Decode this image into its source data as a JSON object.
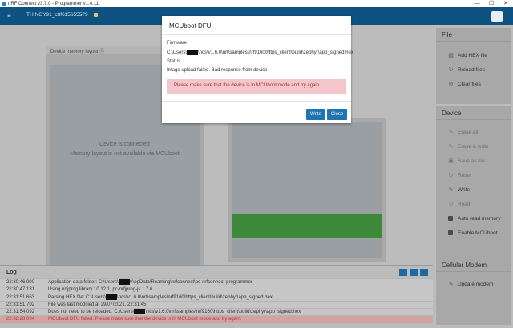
{
  "window": {
    "title": "nRF Connect v3.7.0 - Programmer v1.4.11",
    "controls": [
      "—",
      "☐",
      "✕"
    ]
  },
  "nav": {
    "menu_icon": "≡",
    "device_name": "THINGY91_c8f615655579",
    "device_chevron": "▾"
  },
  "workspace": {
    "left_panel_title": "Device memory layout",
    "left_panel_info_icon": "ⓘ",
    "left_panel_collapse": "▭",
    "device_connected": "Device is connected",
    "memory_layout_unavailable": "Memory layout is not available via MCUboot"
  },
  "sidebar": {
    "file": {
      "title": "File",
      "items": [
        {
          "label": "Add HEX file",
          "icon": "▤"
        },
        {
          "label": "Reload files",
          "icon": "↻"
        },
        {
          "label": "Clear files",
          "icon": "⊘"
        }
      ]
    },
    "device": {
      "title": "Device",
      "items": [
        {
          "label": "Erase all",
          "icon": "✎",
          "disabled": true
        },
        {
          "label": "Erase & write",
          "icon": "✎",
          "disabled": true
        },
        {
          "label": "Save as file",
          "icon": "▣",
          "disabled": true
        },
        {
          "label": "Reset",
          "icon": "↻",
          "disabled": true
        },
        {
          "label": "Write",
          "icon": "✎",
          "disabled": false
        },
        {
          "label": "Read",
          "icon": "↻",
          "disabled": true
        }
      ],
      "checkboxes": [
        {
          "label": "Auto read memory",
          "checked": true
        },
        {
          "label": "Enable MCUboot",
          "checked": true
        }
      ]
    },
    "cellular": {
      "title": "Cellular Modem",
      "items": [
        {
          "label": "Update modem",
          "icon": "✎"
        }
      ]
    }
  },
  "log": {
    "title": "Log",
    "entries": [
      {
        "time": "22:30:46.990",
        "pre": "Application data folder: C:\\Users\\",
        "post": "\\AppData\\Roaming\\nrfconnect\\pc-nrfconnect-programmer",
        "redacted": true,
        "error": false
      },
      {
        "time": "22:30:47.131",
        "pre": "Using nrfjprog library 10.12.1, pc-nrfjprog-js 1.7.6",
        "post": "",
        "redacted": false,
        "error": false
      },
      {
        "time": "22:31:51.663",
        "pre": "Parsing HEX file: C:\\Users\\",
        "post": "\\ncs\\v1.6.0\\nrf\\samples\\nrf9160\\https_client\\build\\zephyr\\app_signed.hex",
        "redacted": true,
        "error": false
      },
      {
        "time": "22:31:51.702",
        "pre": "File was last modified at 29/07/2021, 22:31:45",
        "post": "",
        "redacted": false,
        "error": false
      },
      {
        "time": "22:31:54.092",
        "pre": "Does not need to be reloaded: C:\\Users\\",
        "post": "\\ncs\\v1.6.0\\nrf\\samples\\nrf9160\\https_client\\build\\zephyr\\app_signed.hex",
        "redacted": true,
        "error": false
      },
      {
        "time": "22:32:28.034",
        "pre": "MCUboot DFU failed. Please make sure that the device is in MCUboot mode and try again.",
        "post": "",
        "redacted": false,
        "error": true
      }
    ]
  },
  "modal": {
    "title": "MCUboot DFU",
    "firmware_label": "Firmware",
    "firmware_pre": "C:\\Users\\",
    "firmware_post": "\\ncs\\v1.6.0\\nrf\\samples\\nrf9160\\https_client\\build\\zephyr\\app_signed.hex",
    "status_label": "Status",
    "status_value": "Image upload failed. Bad response from device",
    "alert": "Please make sure that the device is in MCUboot mode and try again.",
    "write_label": "Write",
    "close_label": "Close"
  },
  "colors": {
    "nav": "#0d5280",
    "accent": "#1f74b4",
    "green_region": "#3f8a3a",
    "error_text": "#b83a3a",
    "alert_bg": "#f3c6cb"
  }
}
